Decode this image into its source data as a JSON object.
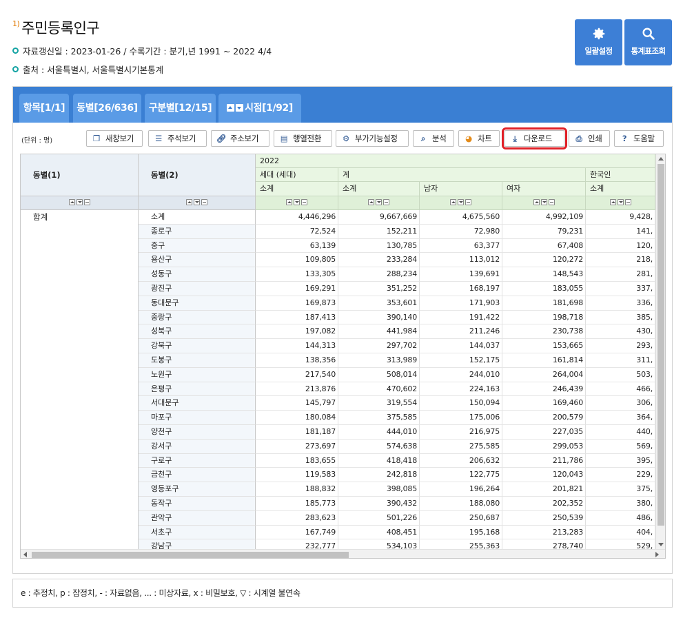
{
  "header": {
    "footnote_mark": "1)",
    "title": "주민등록인구",
    "update_info": "자료갱신일 : 2023-01-26 / 수록기간 : 분기,년 1991 ~ 2022 4/4",
    "source_info": "출처 : 서울특별시, 서울특별시기본통계"
  },
  "top_buttons": {
    "bulk_settings": "일괄설정",
    "stat_table_search": "통계표조회"
  },
  "tabs": [
    {
      "label": "항목[1/1]"
    },
    {
      "label": "동별[26/636]"
    },
    {
      "label": "구분별[12/15]"
    },
    {
      "label": "시점[1/92]"
    }
  ],
  "toolbar": {
    "unit": "(단위 : 명)",
    "buttons": [
      {
        "label": "새창보기",
        "icon": "window-icon"
      },
      {
        "label": "주석보기",
        "icon": "comment-icon"
      },
      {
        "label": "주소보기",
        "icon": "link-icon"
      },
      {
        "label": "행열전환",
        "icon": "pivot-icon"
      },
      {
        "label": "부가기능설정",
        "icon": "gear-icon"
      },
      {
        "label": "분석",
        "icon": "analysis-icon"
      },
      {
        "label": "차트",
        "icon": "pie-chart-icon"
      },
      {
        "label": "다운로드",
        "icon": "download-icon"
      },
      {
        "label": "인쇄",
        "icon": "print-icon"
      },
      {
        "label": "도움말",
        "icon": "help-icon"
      }
    ],
    "highlighted": "다운로드"
  },
  "table": {
    "row_header_1": "동별(1)",
    "row_header_2": "동별(2)",
    "year": "2022",
    "group_households": "세대 (세대)",
    "group_total": "계",
    "group_korean": "한국인",
    "sub_headers": [
      "소계",
      "소계",
      "남자",
      "여자",
      "소계"
    ],
    "row_group_label": "합계",
    "rows": [
      {
        "name": "소계",
        "v": [
          "4,446,296",
          "9,667,669",
          "4,675,560",
          "4,992,109",
          "9,428,"
        ]
      },
      {
        "name": "종로구",
        "v": [
          "72,524",
          "152,211",
          "72,980",
          "79,231",
          "141,"
        ]
      },
      {
        "name": "중구",
        "v": [
          "63,139",
          "130,785",
          "63,377",
          "67,408",
          "120,"
        ]
      },
      {
        "name": "용산구",
        "v": [
          "109,805",
          "233,284",
          "113,012",
          "120,272",
          "218,"
        ]
      },
      {
        "name": "성동구",
        "v": [
          "133,305",
          "288,234",
          "139,691",
          "148,543",
          "281,"
        ]
      },
      {
        "name": "광진구",
        "v": [
          "169,291",
          "351,252",
          "168,197",
          "183,055",
          "337,"
        ]
      },
      {
        "name": "동대문구",
        "v": [
          "169,873",
          "353,601",
          "171,903",
          "181,698",
          "336,"
        ]
      },
      {
        "name": "중랑구",
        "v": [
          "187,413",
          "390,140",
          "191,422",
          "198,718",
          "385,"
        ]
      },
      {
        "name": "성북구",
        "v": [
          "197,082",
          "441,984",
          "211,246",
          "230,738",
          "430,"
        ]
      },
      {
        "name": "강북구",
        "v": [
          "144,313",
          "297,702",
          "144,037",
          "153,665",
          "293,"
        ]
      },
      {
        "name": "도봉구",
        "v": [
          "138,356",
          "313,989",
          "152,175",
          "161,814",
          "311,"
        ]
      },
      {
        "name": "노원구",
        "v": [
          "217,540",
          "508,014",
          "244,010",
          "264,004",
          "503,"
        ]
      },
      {
        "name": "은평구",
        "v": [
          "213,876",
          "470,602",
          "224,163",
          "246,439",
          "466,"
        ]
      },
      {
        "name": "서대문구",
        "v": [
          "145,797",
          "319,554",
          "150,094",
          "169,460",
          "306,"
        ]
      },
      {
        "name": "마포구",
        "v": [
          "180,084",
          "375,585",
          "175,006",
          "200,579",
          "364,"
        ]
      },
      {
        "name": "양천구",
        "v": [
          "181,187",
          "444,010",
          "216,975",
          "227,035",
          "440,"
        ]
      },
      {
        "name": "강서구",
        "v": [
          "273,697",
          "574,638",
          "275,585",
          "299,053",
          "569,"
        ]
      },
      {
        "name": "구로구",
        "v": [
          "183,655",
          "418,418",
          "206,632",
          "211,786",
          "395,"
        ]
      },
      {
        "name": "금천구",
        "v": [
          "119,583",
          "242,818",
          "122,775",
          "120,043",
          "229,"
        ]
      },
      {
        "name": "영등포구",
        "v": [
          "188,832",
          "398,085",
          "196,264",
          "201,821",
          "375,"
        ]
      },
      {
        "name": "동작구",
        "v": [
          "185,773",
          "390,432",
          "188,080",
          "202,352",
          "380,"
        ]
      },
      {
        "name": "관악구",
        "v": [
          "283,623",
          "501,226",
          "250,687",
          "250,539",
          "486,"
        ]
      },
      {
        "name": "서초구",
        "v": [
          "167,749",
          "408,451",
          "195,168",
          "213,283",
          "404,"
        ]
      },
      {
        "name": "강남구",
        "v": [
          "232,777",
          "534,103",
          "255,363",
          "278,740",
          "529,"
        ]
      }
    ]
  },
  "legend": "e : 추정치, p : 잠정치, - : 자료없음, ... : 미상자료, x : 비밀보호, ▽ : 시계열 불연속",
  "colors": {
    "accent": "#3a7fd3",
    "tab": "#5a9be6",
    "highlight": "#e01f26",
    "info_dot": "#13a3a3"
  }
}
